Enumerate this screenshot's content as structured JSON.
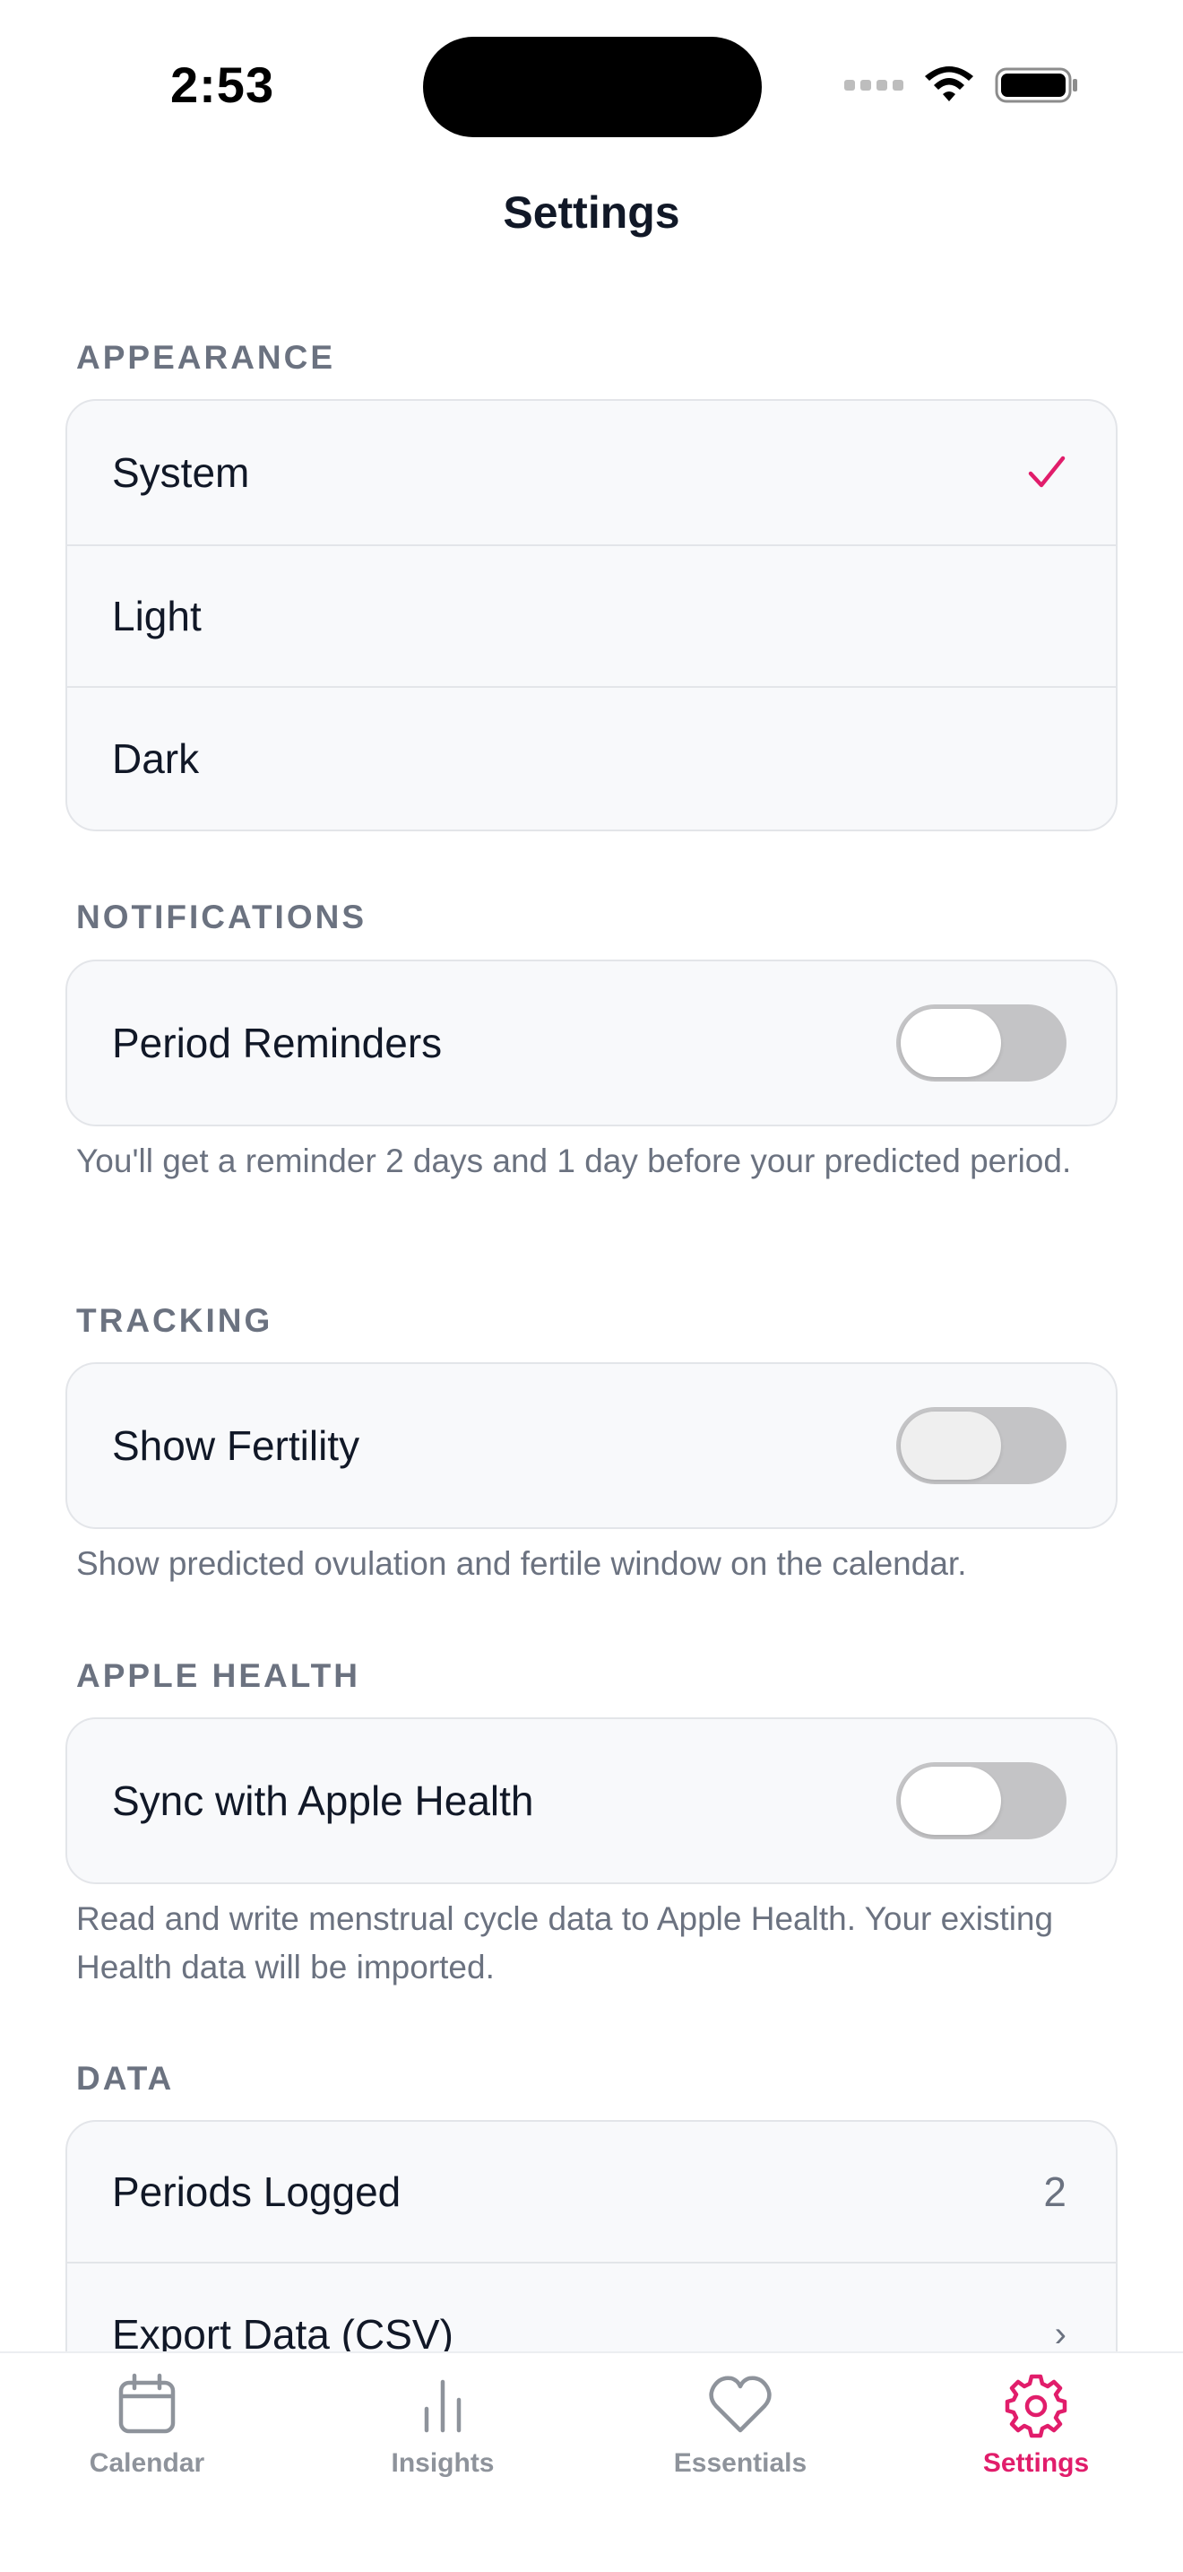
{
  "status_bar": {
    "time": "2:53"
  },
  "header": {
    "title": "Settings"
  },
  "appearance": {
    "header": "APPEARANCE",
    "options": [
      {
        "label": "System",
        "selected": true
      },
      {
        "label": "Light",
        "selected": false
      },
      {
        "label": "Dark",
        "selected": false
      }
    ]
  },
  "notifications": {
    "header": "NOTIFICATIONS",
    "period_reminders": {
      "label": "Period Reminders",
      "enabled": false
    },
    "footnote": "You'll get a reminder 2 days and 1 day before your predicted period."
  },
  "tracking": {
    "header": "TRACKING",
    "show_fertility": {
      "label": "Show Fertility",
      "enabled": false
    },
    "footnote": "Show predicted ovulation and fertile window on the calendar."
  },
  "apple_health": {
    "header": "APPLE HEALTH",
    "sync": {
      "label": "Sync with Apple Health",
      "enabled": false
    },
    "footnote": "Read and write menstrual cycle data to Apple Health. Your existing Health data will be imported."
  },
  "data": {
    "header": "DATA",
    "periods_logged": {
      "label": "Periods Logged",
      "value": "2"
    },
    "export": {
      "label": "Export Data (CSV)",
      "chevron": "›"
    }
  },
  "tab_bar": {
    "tabs": [
      {
        "label": "Calendar",
        "icon": "calendar-icon",
        "active": false
      },
      {
        "label": "Insights",
        "icon": "bar-chart-icon",
        "active": false
      },
      {
        "label": "Essentials",
        "icon": "heart-icon",
        "active": false
      },
      {
        "label": "Settings",
        "icon": "gear-icon",
        "active": true
      }
    ]
  },
  "colors": {
    "accent": "#e11d6b",
    "secondary_text": "#6b7280",
    "card_bg": "#f8f9fb",
    "toggle_off": "#c4c4c6"
  }
}
